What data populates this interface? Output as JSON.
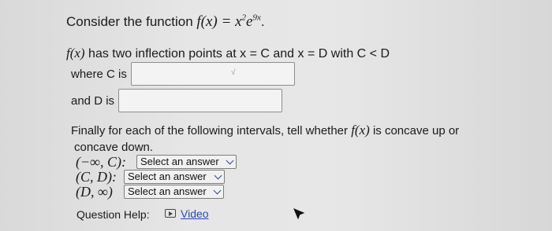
{
  "question": {
    "intro": "Consider the function ",
    "function_lhs": "f(x) = ",
    "function_base": "x",
    "function_exp1": "2",
    "function_mid": "e",
    "function_exp2": "9x",
    "function_end": ".",
    "inflection_fx": "f(x)",
    "inflection_text": " has two inflection points at x = C and x = D with C < D",
    "where_c_label": "where C is",
    "and_d_label": "and D is",
    "concavity_line1_pre": "Finally for each of the following intervals, tell whether ",
    "concavity_fx": "f(x)",
    "concavity_line1_post": " is concave up or",
    "concavity_line2": "concave down.",
    "intervals": [
      {
        "label": "(−∞, C):",
        "select_value": "Select an answer"
      },
      {
        "label": "(C, D):",
        "select_value": "Select an answer"
      },
      {
        "label": "(D, ∞)",
        "select_value": "Select an answer"
      }
    ],
    "c_answer_value": "",
    "d_answer_value": ""
  },
  "help": {
    "label": "Question Help:",
    "video_icon": "video-play-icon",
    "video_link": "Video"
  },
  "colors": {
    "link": "#2a46b8",
    "chevron": "#2b4a8a"
  }
}
